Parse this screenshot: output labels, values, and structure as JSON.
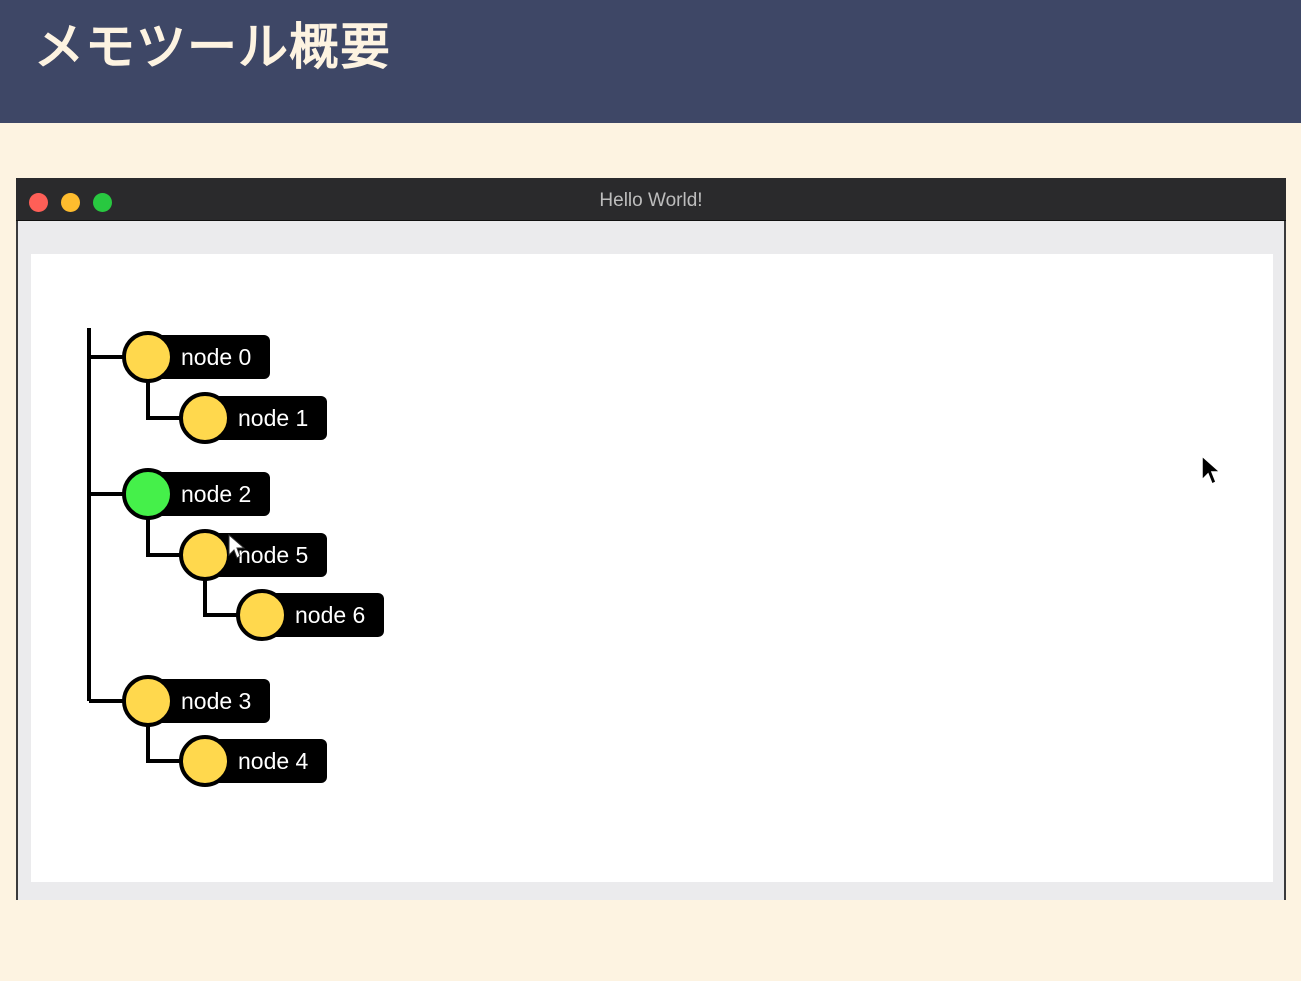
{
  "slide": {
    "title": "メモツール概要"
  },
  "window": {
    "title": "Hello World!"
  },
  "tree": {
    "colors": {
      "default": "#ffd84d",
      "selected": "#45f04a",
      "label_bg": "#000000",
      "line": "#000000"
    },
    "nodes": [
      {
        "label": "node 0",
        "depth": 0,
        "selected": false,
        "children": [
          {
            "label": "node 1",
            "depth": 1,
            "selected": false,
            "children": []
          }
        ]
      },
      {
        "label": "node 2",
        "depth": 0,
        "selected": true,
        "children": [
          {
            "label": "node 5",
            "depth": 1,
            "selected": false,
            "children": [
              {
                "label": "node 6",
                "depth": 2,
                "selected": false,
                "children": []
              }
            ]
          }
        ]
      },
      {
        "label": "node 3",
        "depth": 0,
        "selected": false,
        "children": [
          {
            "label": "node 4",
            "depth": 1,
            "selected": false,
            "children": []
          }
        ]
      }
    ]
  }
}
